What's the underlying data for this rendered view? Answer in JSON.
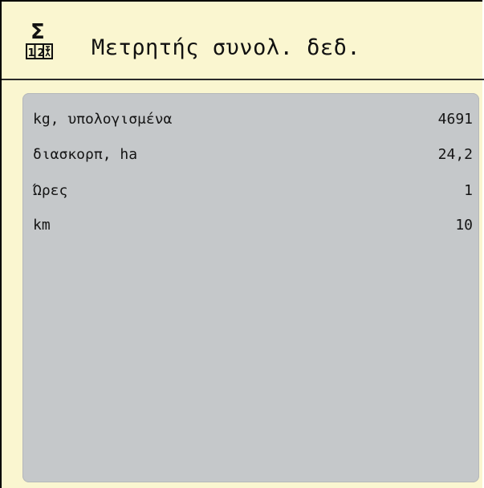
{
  "header": {
    "title": "Μετρητής συνολ. δεδ.",
    "icon": "sigma-counter-icon",
    "icon_sigma": "Σ",
    "icon_digits": "12"
  },
  "rows": [
    {
      "label": "kg, υπολογισμένα",
      "value": "4691"
    },
    {
      "label": "διασκορπ, ha",
      "value": "24,2"
    },
    {
      "label": "Ώρες",
      "value": "1"
    },
    {
      "label": "km",
      "value": "10"
    }
  ],
  "colors": {
    "background": "#faf6d0",
    "panel": "#c5c8ca",
    "text": "#151515"
  }
}
